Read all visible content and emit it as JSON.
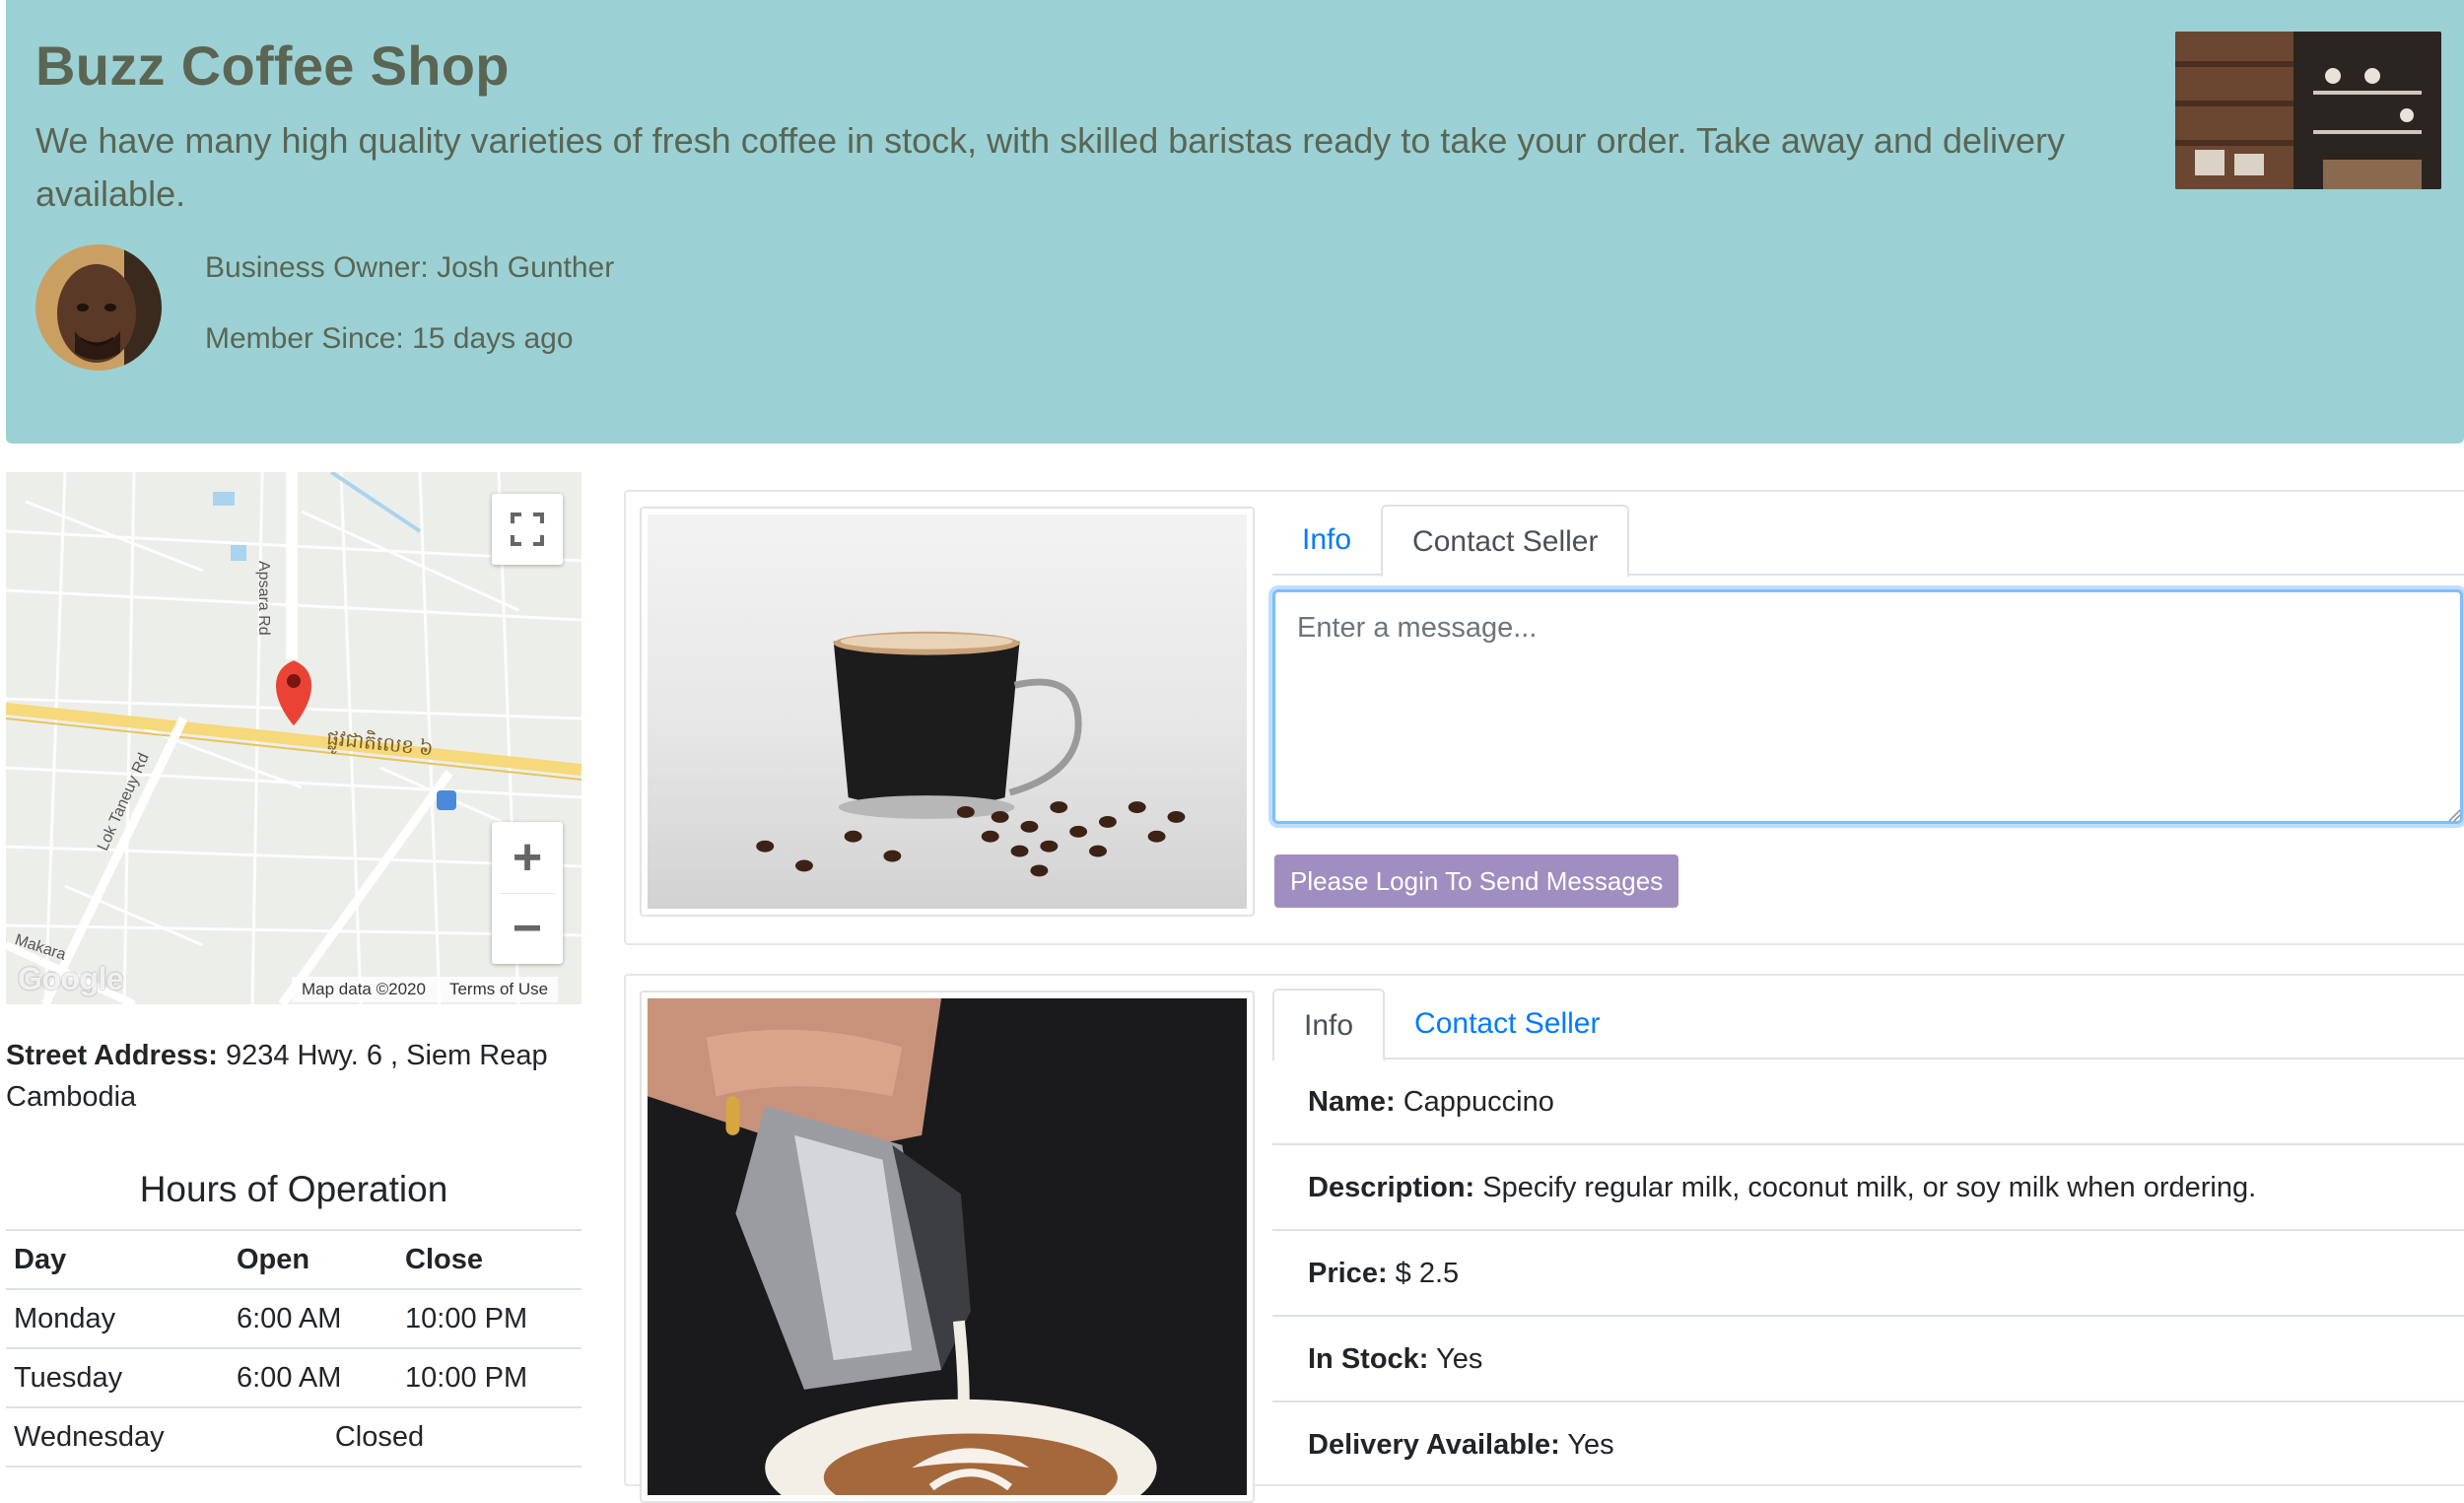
{
  "shop": {
    "title": "Buzz Coffee Shop",
    "description": "We have many high quality varieties of fresh coffee in stock, with skilled baristas ready to take your order. Take away and delivery available.",
    "owner_label": "Business Owner: Josh Gunther",
    "member_label": "Member Since: 15 days ago"
  },
  "map": {
    "road_labels": [
      "Apsara Rd",
      "Lok Taneuy Rd",
      "ផ្លូវជាតិលេខ ៦",
      "Makara"
    ],
    "google_logo": "Google",
    "attribution": "Map data ©2020",
    "terms": "Terms of Use",
    "zoom_in": "+",
    "zoom_out": "−"
  },
  "address": {
    "label": "Street Address:",
    "value": "9234 Hwy. 6 , Siem Reap Cambodia"
  },
  "hours": {
    "title": "Hours of Operation",
    "headers": [
      "Day",
      "Open",
      "Close"
    ],
    "rows": [
      {
        "day": "Monday",
        "open": "6:00 AM",
        "close": "10:00 PM"
      },
      {
        "day": "Tuesday",
        "open": "6:00 AM",
        "close": "10:00 PM"
      },
      {
        "day": "Wednesday",
        "closed": "Closed"
      }
    ]
  },
  "products": [
    {
      "tabs": [
        "Info",
        "Contact Seller"
      ],
      "active_tab": "Contact Seller",
      "message_placeholder": "Enter a message...",
      "button_label": "Please Login To Send Messages"
    },
    {
      "tabs": [
        "Info",
        "Contact Seller"
      ],
      "active_tab": "Info",
      "fields": [
        {
          "label": "Name:",
          "value": "Cappuccino"
        },
        {
          "label": "Description:",
          "value": "Specify regular milk, coconut milk, or soy milk when ordering."
        },
        {
          "label": "Price:",
          "value": "$ 2.5"
        },
        {
          "label": "In Stock:",
          "value": "Yes"
        },
        {
          "label": "Delivery Available:",
          "value": "Yes"
        }
      ]
    }
  ],
  "colors": {
    "hero_bg": "#9bd1d4",
    "hero_text": "#5b6553",
    "link": "#007bff",
    "button_bg": "#a08ec0",
    "focus_border": "#80bdff"
  }
}
